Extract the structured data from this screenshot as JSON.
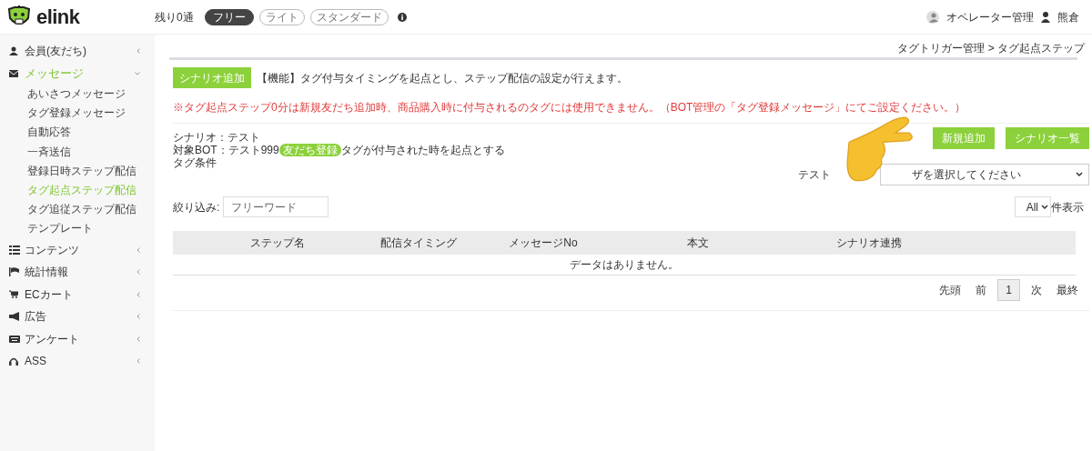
{
  "header": {
    "logo": "elink",
    "remaining": "残り0通",
    "plans": [
      {
        "label": "フリー",
        "selected": true
      },
      {
        "label": "ライト",
        "selected": false
      },
      {
        "label": "スタンダード",
        "selected": false
      }
    ],
    "operator": "オペレーター管理",
    "user": "熊倉"
  },
  "sidebar": {
    "items": [
      {
        "label": "会員(友だち)",
        "expanded": false
      },
      {
        "label": "メッセージ",
        "expanded": true,
        "children": [
          {
            "label": "あいさつメッセージ",
            "selected": false
          },
          {
            "label": "タグ登録メッセージ",
            "selected": false
          },
          {
            "label": "自動応答",
            "selected": false
          },
          {
            "label": "一斉送信",
            "selected": false
          },
          {
            "label": "登録日時ステップ配信",
            "selected": false
          },
          {
            "label": "タグ起点ステップ配信",
            "selected": true
          },
          {
            "label": "タグ追従ステップ配信",
            "selected": false
          },
          {
            "label": "テンプレート",
            "selected": false
          }
        ]
      },
      {
        "label": "コンテンツ",
        "expanded": false
      },
      {
        "label": "統計情報",
        "expanded": false
      },
      {
        "label": "ECカート",
        "expanded": false
      },
      {
        "label": "広告",
        "expanded": false
      },
      {
        "label": "アンケート",
        "expanded": false
      },
      {
        "label": "ASS",
        "expanded": false
      }
    ]
  },
  "breadcrumb": "タグトリガー管理 > タグ起点ステップ",
  "add_scenario_button": "シナリオ追加",
  "description": "【機能】タグ付与タイミングを起点とし、ステップ配信の設定が行えます。",
  "warning": "※タグ起点ステップ0分は新規友だち追加時、商品購入時に付与されるのタグには使用できません。（BOT管理の「タグ登録メッセージ」にてご設定ください。）",
  "scenario": "シナリオ：テスト",
  "target_prefix": "対象BOT：テスト999",
  "tag": "友だち登録",
  "target_suffix": "タグが付与された時を起点とする",
  "tag_condition": "タグ条件",
  "buttons": [
    "新規追加",
    "シナリオ一覧"
  ],
  "test_label": "テスト",
  "test_select": {
    "value": "ザを選択してください"
  },
  "filter": {
    "label": "絞り込み:",
    "placeholder": "フリーワード"
  },
  "page_size": {
    "value": "All",
    "suffix": "件表示"
  },
  "table": {
    "columns": [
      "ステップ名",
      "配信タイミング",
      "メッセージNo",
      "本文",
      "シナリオ連携"
    ],
    "empty": "データはありません。"
  },
  "pagination": [
    {
      "label": "先頭",
      "selected": false
    },
    {
      "label": "前",
      "selected": false
    },
    {
      "label": "1",
      "selected": true
    },
    {
      "label": "次",
      "selected": false
    },
    {
      "label": "最終",
      "selected": false
    }
  ]
}
